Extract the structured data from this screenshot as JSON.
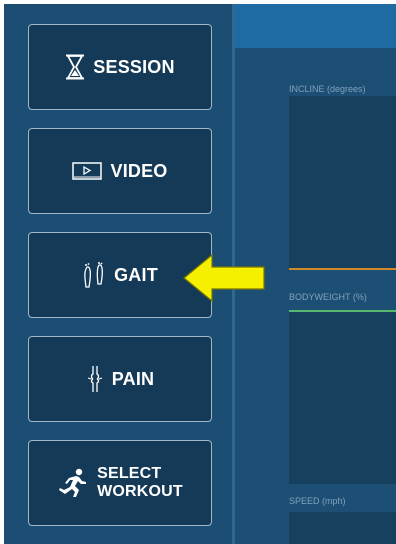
{
  "sidebar": {
    "items": [
      {
        "label": "SESSION",
        "icon": "hourglass-icon"
      },
      {
        "label": "VIDEO",
        "icon": "video-player-icon"
      },
      {
        "label": "GAIT",
        "icon": "footprints-icon"
      },
      {
        "label": "PAIN",
        "icon": "knee-joint-icon"
      },
      {
        "label_line1": "SELECT",
        "label_line2": "WORKOUT",
        "icon": "running-figure-icon"
      }
    ]
  },
  "main": {
    "panels": {
      "incline": "INCLINE (degrees)",
      "bodyweight": "BODYWEIGHT (%)",
      "speed": "SPEED (mph)"
    }
  },
  "annotation": {
    "icon": "yellow-arrow-icon",
    "color": "#f4f000"
  },
  "colors": {
    "sidebar": "#1c4d72",
    "button": "#153a58",
    "topbar": "#1f6aa3",
    "incline_line": "#d08a2a",
    "bodyweight_line": "#56b76f"
  }
}
